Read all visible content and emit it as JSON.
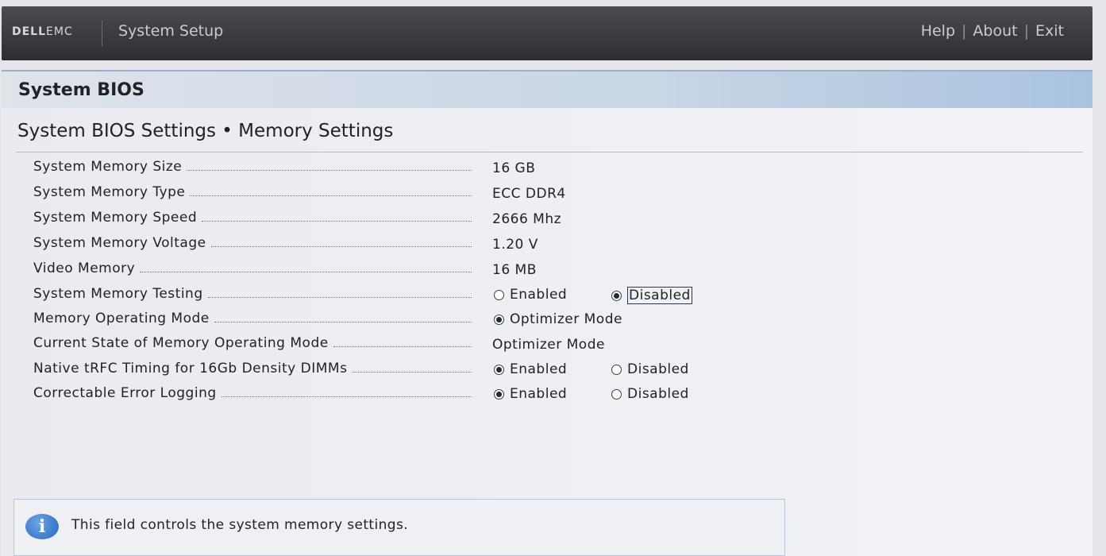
{
  "header": {
    "brand_strong": "DELL",
    "brand_light": "EMC",
    "app_title": "System Setup",
    "links": [
      "Help",
      "About",
      "Exit"
    ],
    "separator": "|"
  },
  "section": {
    "title": "System BIOS"
  },
  "page": {
    "title": "System BIOS Settings • Memory Settings"
  },
  "settings": [
    {
      "label": "System Memory Size",
      "value": "16 GB"
    },
    {
      "label": "System Memory Type",
      "value": "ECC DDR4"
    },
    {
      "label": "System Memory Speed",
      "value": "2666 Mhz"
    },
    {
      "label": "System Memory Voltage",
      "value": "1.20 V"
    },
    {
      "label": "Video Memory",
      "value": "16 MB"
    },
    {
      "label": "System Memory Testing",
      "options": [
        "Enabled",
        "Disabled"
      ],
      "selected": "Disabled",
      "focused": "Disabled"
    },
    {
      "label": "Memory Operating Mode",
      "options": [
        "Optimizer Mode"
      ],
      "selected": "Optimizer Mode"
    },
    {
      "label": "Current State of Memory Operating Mode",
      "value": "Optimizer Mode"
    },
    {
      "label": "Native tRFC Timing for 16Gb Density DIMMs",
      "options": [
        "Enabled",
        "Disabled"
      ],
      "selected": "Enabled"
    },
    {
      "label": "Correctable Error Logging",
      "options": [
        "Enabled",
        "Disabled"
      ],
      "selected": "Enabled"
    }
  ],
  "help": {
    "icon": "info-icon",
    "text": "This field controls the system memory settings."
  },
  "colors": {
    "header_bg": "#2c2e31",
    "section_bar": "#a9c3df",
    "info_icon": "#2566c0"
  }
}
